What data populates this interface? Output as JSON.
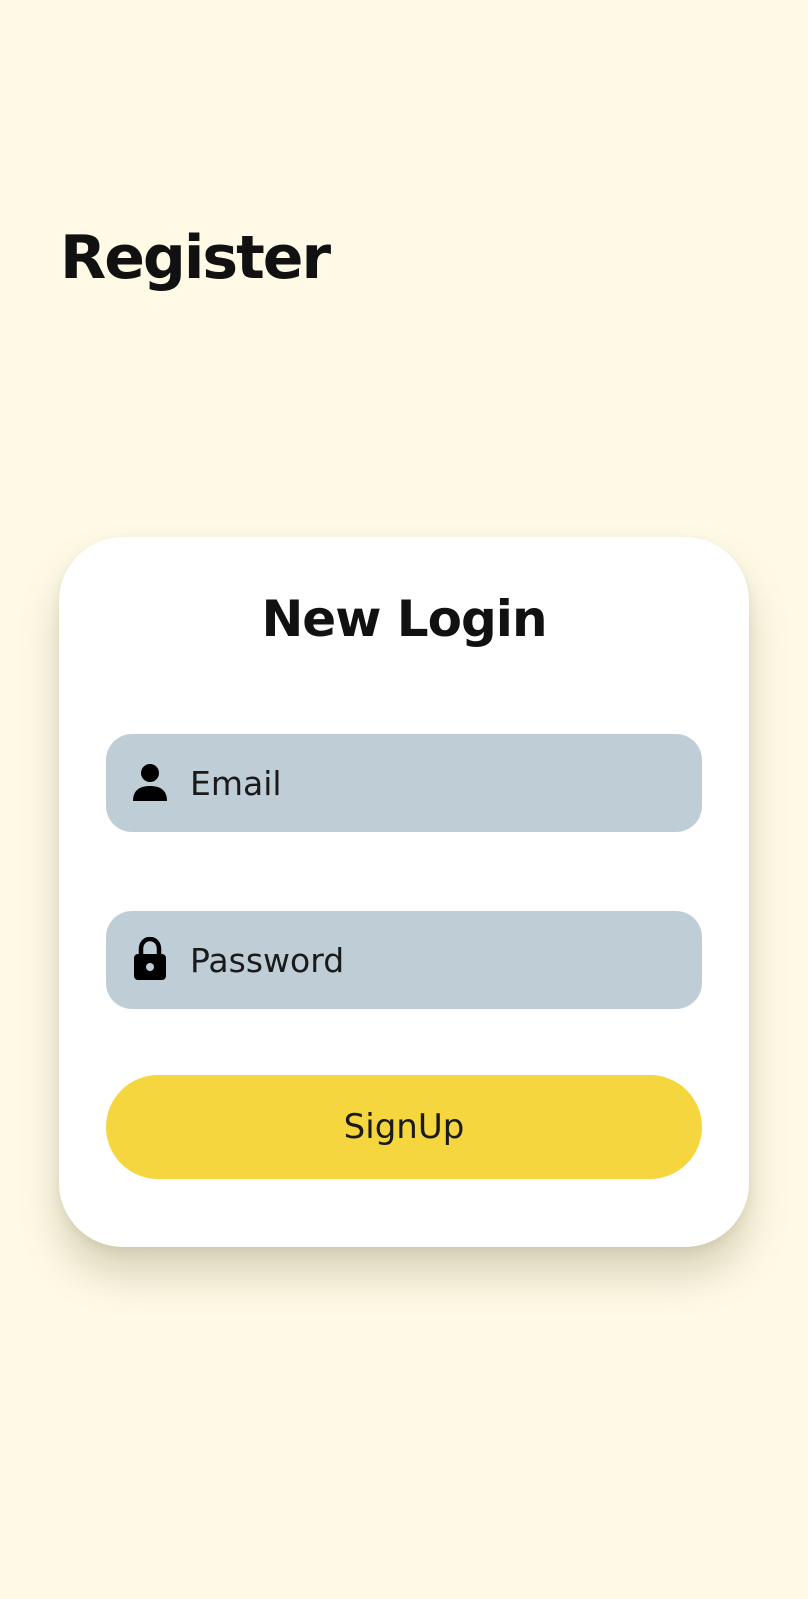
{
  "page": {
    "title": "Register",
    "background_color": "#FEFAE6"
  },
  "card": {
    "title": "New Login",
    "email_field": {
      "placeholder": "Email",
      "value": "",
      "icon": "person-icon"
    },
    "password_field": {
      "placeholder": "Password",
      "value": "",
      "icon": "lock-icon"
    },
    "signup_button": {
      "label": "SignUp",
      "color": "#F6D63E"
    },
    "field_color": "#BFCDD7"
  }
}
